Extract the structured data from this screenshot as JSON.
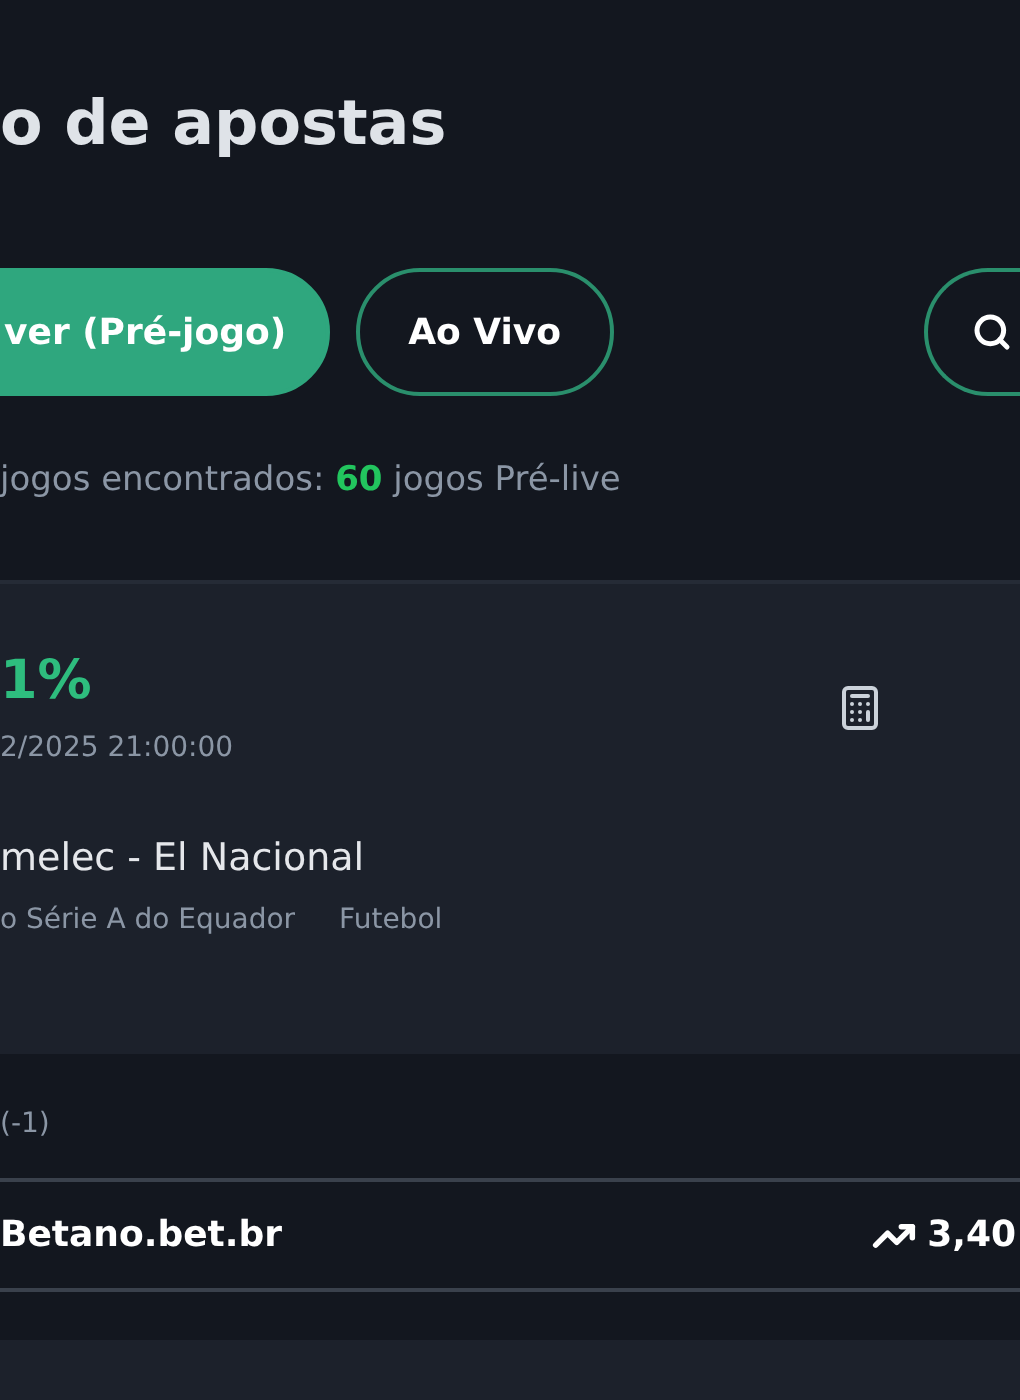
{
  "page_title": "o de apostas",
  "tabs": [
    {
      "label": "ver (Pré-jogo)",
      "selected": true
    },
    {
      "label": "Ao Vivo",
      "selected": false
    }
  ],
  "summary": "jogos encontrados: **60** jogos Pré-live",
  "opportunity": {
    "percent": "1%",
    "datetime": "2/2025 21:00:00",
    "match": "melec - El Nacional",
    "league": "o Série A do Equador",
    "sport": "Futebol"
  },
  "market": "(-1)",
  "bookmakers": [
    {
      "name": "Betano.bet.br",
      "odds": "3,40"
    }
  ]
}
